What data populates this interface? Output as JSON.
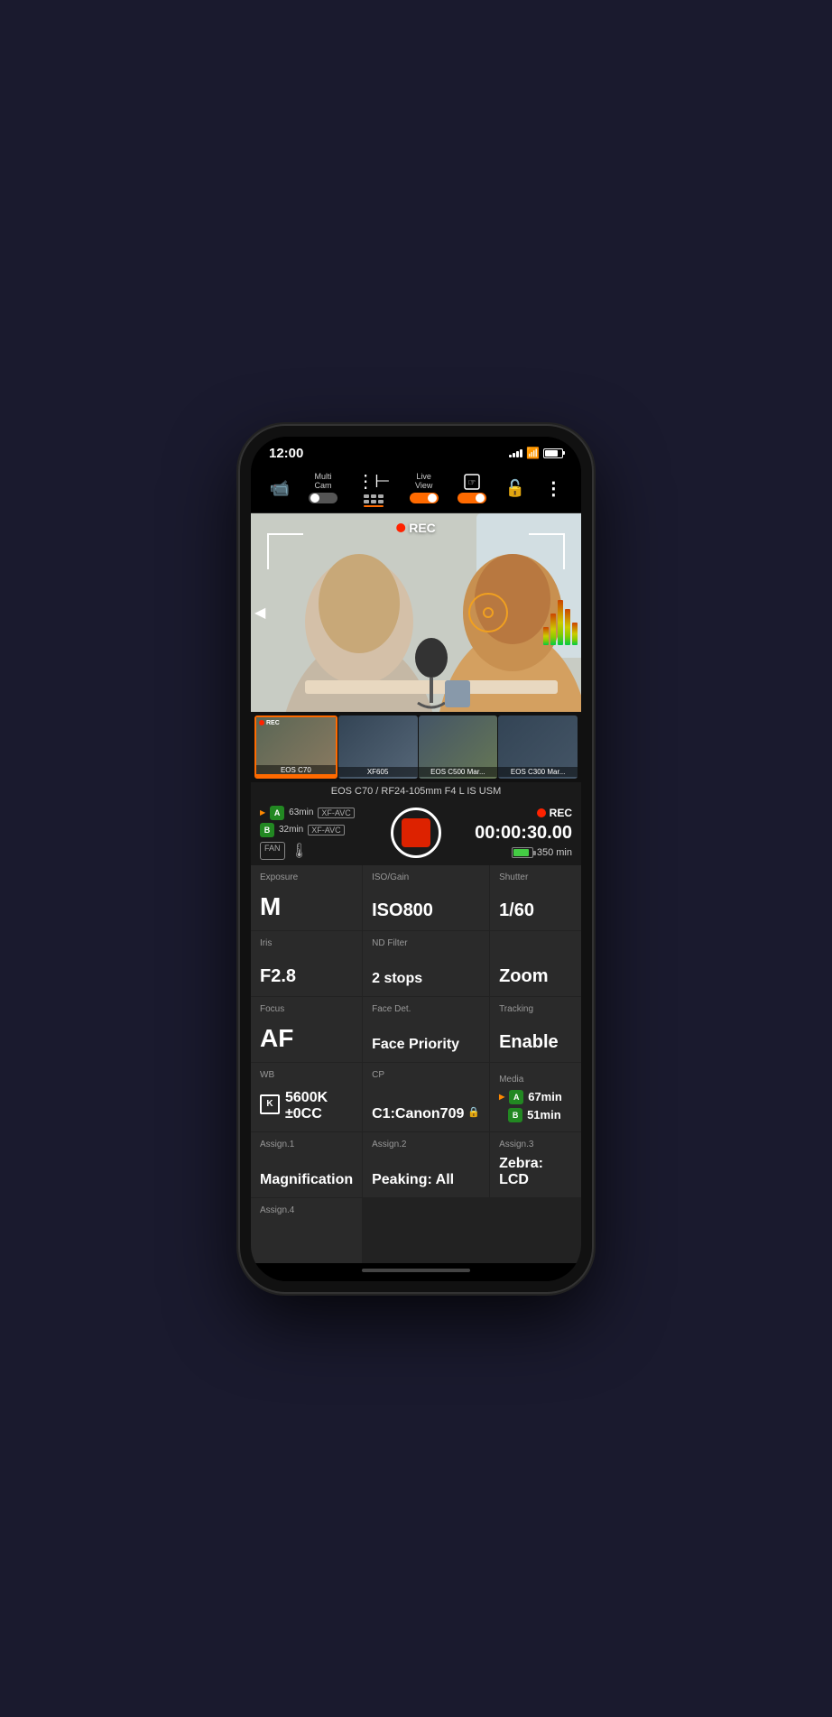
{
  "status_bar": {
    "time": "12:00",
    "signal_bars": [
      3,
      5,
      7,
      9,
      11
    ],
    "battery_label": ""
  },
  "toolbar": {
    "camera_icon": "📹",
    "multicam_label": "Multi\nCam",
    "multicam_toggle": "off",
    "grid_icon": "⊞",
    "liveview_label": "Live\nView",
    "liveview_toggle": "on",
    "touch_icon": "☞",
    "touch_toggle": "on",
    "lock_icon": "🔓",
    "more_icon": "⋮"
  },
  "viewfinder": {
    "rec_label": "REC"
  },
  "camera_thumbnails": [
    {
      "label": "EOS C70",
      "active": true,
      "rec": true
    },
    {
      "label": "XF605",
      "active": false,
      "rec": false
    },
    {
      "label": "EOS C500 Mar...",
      "active": false,
      "rec": false
    },
    {
      "label": "EOS C300 Mar...",
      "active": false,
      "rec": false
    }
  ],
  "cam_info": {
    "model": "EOS C70 / RF24-105mm F4 L IS USM"
  },
  "rec_status": {
    "slot_a_time": "63min",
    "slot_b_time": "32min",
    "codec_a": "XF-AVC",
    "codec_b": "XF-AVC",
    "rec_label": "REC",
    "timer": "00:00:30.00",
    "battery_time": "350 min"
  },
  "controls": {
    "exposure": {
      "label": "Exposure",
      "value": "M"
    },
    "iso": {
      "label": "ISO/Gain",
      "value": "ISO800"
    },
    "shutter": {
      "label": "Shutter",
      "value": "1/60"
    },
    "iris": {
      "label": "Iris",
      "value": "F2.8"
    },
    "nd_filter": {
      "label": "ND Filter",
      "value": "2 stops"
    },
    "zoom": {
      "label": "",
      "value": "Zoom"
    },
    "focus": {
      "label": "Focus",
      "value": "AF"
    },
    "face_det": {
      "label": "Face Det.",
      "value": "Face Priority"
    },
    "tracking": {
      "label": "Tracking",
      "value": "Enable"
    },
    "wb": {
      "label": "WB",
      "k_badge": "K",
      "value": "5600K\n±0CC"
    },
    "cp": {
      "label": "CP",
      "value": "C1:Canon709",
      "lock": "🔒"
    },
    "media": {
      "label": "Media",
      "slot_a_time": "67min",
      "slot_b_time": "51min"
    },
    "assign1": {
      "label": "Assign.1",
      "value": "Magnification"
    },
    "assign2": {
      "label": "Assign.2",
      "value": "Peaking: All"
    },
    "assign3": {
      "label": "Assign.3",
      "value": "Zebra: LCD"
    },
    "assign4": {
      "label": "Assign.4",
      "value": ""
    }
  }
}
